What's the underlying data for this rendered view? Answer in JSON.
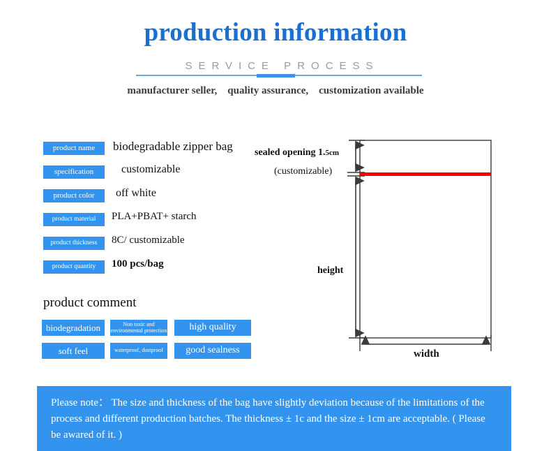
{
  "header": {
    "title": "production information",
    "subtitle": "SERVICE PROCESS",
    "tagline": "manufacturer seller,    quality assurance,    customization available"
  },
  "specs": {
    "rows": [
      {
        "label": "product name",
        "value": "biodegradable zipper bag"
      },
      {
        "label": "specification",
        "value": "customizable"
      },
      {
        "label": "product color",
        "value": "off white"
      },
      {
        "label": "product material",
        "value": "PLA+PBAT+ starch"
      },
      {
        "label": "product thickness",
        "value": "8C/ customizable"
      },
      {
        "label": "product quantity",
        "value": "100 pcs/bag"
      }
    ]
  },
  "comment": {
    "title": "product comment",
    "tags": [
      [
        "biodegradation",
        "Non toxic and environmental protection",
        "high quality"
      ],
      [
        "soft feel",
        "waterproof, dustproof",
        "good sealness"
      ]
    ]
  },
  "diagram": {
    "sealed_opening_label": "sealed opening 1.",
    "sealed_opening_value": "5cm",
    "customizable_label": "(customizable)",
    "height_label": "height",
    "width_label": "width",
    "zipper_color": "#ff0000",
    "outline_color": "#3a3a3a"
  },
  "note": {
    "text": "Please note：  The size and thickness of the bag have slightly deviation because of  the limitations of the process and different production batches. The thickness ± 1c and the size ± 1cm are acceptable. ( Please be awared of it. )"
  },
  "colors": {
    "title_blue": "#1a6fd4",
    "badge_blue": "#3394ef",
    "rule_blue": "#6aa9e0",
    "rule_center_blue": "#3d92e5",
    "note_blue": "#3394ef"
  }
}
